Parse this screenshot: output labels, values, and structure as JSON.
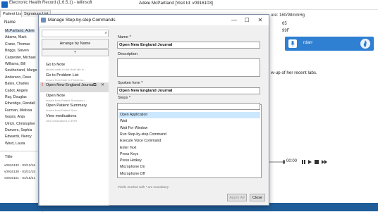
{
  "app": {
    "title": "Electronic Health Record (1.6.5.1) - tellinsoft",
    "patient_header": "Adele McPartland [Visit Id: v0916103]"
  },
  "patient_tabs": [
    "Patient List",
    "Signature List"
  ],
  "patient_list": {
    "header": "Name",
    "items": [
      "McPartland, Adele",
      "Adams, Mark",
      "Crane, Thomas",
      "Briggs, Steven",
      "Carpenter, Michael",
      "Williams, Bill",
      "Southerland, Margo",
      "Anderson, Dave",
      "Bates, Charles",
      "Cabot, Angelo",
      "Ray, Douglas",
      "Etheridge, Randall",
      "Furman, Melissa",
      "Gauss, Anja",
      "Ulrich, Christopher",
      "Danvers, Sophia",
      "Edwards, Nancy",
      "Ward, Laura"
    ]
  },
  "history": {
    "header": "Title",
    "items": [
      "v0916132 - 03/13/16",
      "v0916130 - 03/21/15",
      "v0916101 - 04/15/21"
    ]
  },
  "vitals": {
    "bp": "ure:   160/98mmHg",
    "pulse": "65",
    "temp": "99F"
  },
  "dictation": {
    "text": "rdarr"
  },
  "note_text": "w-up of her recent labs.",
  "audio": {
    "time": "00:00"
  },
  "dialog": {
    "title": "Manage Step-by-step Commands",
    "window_buttons": {
      "minimize": "—",
      "maximize": "☐",
      "close": "✕"
    },
    "search_icon": "⌕",
    "arrange_label": "Arrange by Name",
    "add_label": "+",
    "commands": [
      {
        "name": "Go to Note",
        "desc": "shows cards to the Note tab in...",
        "warn": false,
        "selected": false
      },
      {
        "name": "Go to Problem List",
        "desc": "moves from Note to Problems...",
        "warn": false,
        "selected": false
      },
      {
        "name": "Open New England Journal",
        "desc": "",
        "warn": true,
        "selected": true
      },
      {
        "name": "Open Note",
        "desc": "moves from Patient Summary t...",
        "warn": false,
        "selected": false
      },
      {
        "name": "Open Patient Summary",
        "desc": "moves from Patient Sum...",
        "warn": false,
        "selected": false
      },
      {
        "name": "View medications",
        "desc": "view medications in EHR",
        "warn": false,
        "selected": false
      }
    ],
    "name_label": "Name *",
    "name_value": "Open New England Journal",
    "description_label": "Description",
    "description_value": "",
    "spoken_label": "Spoken form *",
    "spoken_value": "Open New England Journal",
    "steps_label": "Steps *",
    "steps_input": "",
    "steps": [
      "Open Application",
      "Wait",
      "Wait For Window",
      "Run Step-by-step Command",
      "Execute Voice Command",
      "Enter Text",
      "Press Keys",
      "Press Hotkey",
      "Microphone On",
      "Microphone Off"
    ],
    "selected_step": "Open Application",
    "mandatory_note": "Fields marked with * are mandatory",
    "apply_label": "Apply All",
    "close_label": "Close"
  }
}
